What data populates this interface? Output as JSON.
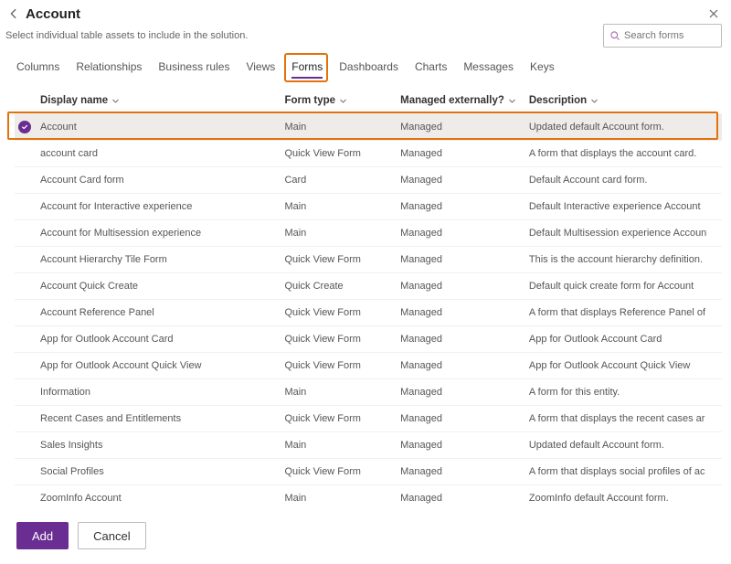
{
  "header": {
    "title": "Account",
    "subtitle": "Select individual table assets to include in the solution."
  },
  "search": {
    "placeholder": "Search forms"
  },
  "tabs": {
    "items": [
      {
        "label": "Columns"
      },
      {
        "label": "Relationships"
      },
      {
        "label": "Business rules"
      },
      {
        "label": "Views"
      },
      {
        "label": "Forms"
      },
      {
        "label": "Dashboards"
      },
      {
        "label": "Charts"
      },
      {
        "label": "Messages"
      },
      {
        "label": "Keys"
      }
    ],
    "active_index": 4,
    "highlighted_index": 4
  },
  "columns": {
    "display_name": "Display name",
    "form_type": "Form type",
    "managed_externally": "Managed externally?",
    "description": "Description"
  },
  "rows": [
    {
      "selected": true,
      "highlighted": true,
      "name": "Account",
      "type": "Main",
      "managed": "Managed",
      "desc": "Updated default Account form."
    },
    {
      "selected": false,
      "highlighted": false,
      "name": "account card",
      "type": "Quick View Form",
      "managed": "Managed",
      "desc": "A form that displays the account card."
    },
    {
      "selected": false,
      "highlighted": false,
      "name": "Account Card form",
      "type": "Card",
      "managed": "Managed",
      "desc": "Default Account card form."
    },
    {
      "selected": false,
      "highlighted": false,
      "name": "Account for Interactive experience",
      "type": "Main",
      "managed": "Managed",
      "desc": "Default Interactive experience Account"
    },
    {
      "selected": false,
      "highlighted": false,
      "name": "Account for Multisession experience",
      "type": "Main",
      "managed": "Managed",
      "desc": "Default Multisession experience Accoun"
    },
    {
      "selected": false,
      "highlighted": false,
      "name": "Account Hierarchy Tile Form",
      "type": "Quick View Form",
      "managed": "Managed",
      "desc": "This is the account hierarchy definition."
    },
    {
      "selected": false,
      "highlighted": false,
      "name": "Account Quick Create",
      "type": "Quick Create",
      "managed": "Managed",
      "desc": "Default quick create form for Account"
    },
    {
      "selected": false,
      "highlighted": false,
      "name": "Account Reference Panel",
      "type": "Quick View Form",
      "managed": "Managed",
      "desc": "A form that displays Reference Panel of"
    },
    {
      "selected": false,
      "highlighted": false,
      "name": "App for Outlook Account Card",
      "type": "Quick View Form",
      "managed": "Managed",
      "desc": "App for Outlook Account Card"
    },
    {
      "selected": false,
      "highlighted": false,
      "name": "App for Outlook Account Quick View",
      "type": "Quick View Form",
      "managed": "Managed",
      "desc": "App for Outlook Account Quick View"
    },
    {
      "selected": false,
      "highlighted": false,
      "name": "Information",
      "type": "Main",
      "managed": "Managed",
      "desc": "A form for this entity."
    },
    {
      "selected": false,
      "highlighted": false,
      "name": "Recent Cases and Entitlements",
      "type": "Quick View Form",
      "managed": "Managed",
      "desc": "A form that displays the recent cases ar"
    },
    {
      "selected": false,
      "highlighted": false,
      "name": "Sales Insights",
      "type": "Main",
      "managed": "Managed",
      "desc": "Updated default Account form."
    },
    {
      "selected": false,
      "highlighted": false,
      "name": "Social Profiles",
      "type": "Quick View Form",
      "managed": "Managed",
      "desc": "A form that displays social profiles of ac"
    },
    {
      "selected": false,
      "highlighted": false,
      "name": "ZoomInfo Account",
      "type": "Main",
      "managed": "Managed",
      "desc": "ZoomInfo default Account form."
    }
  ],
  "footer": {
    "add_label": "Add",
    "cancel_label": "Cancel"
  }
}
